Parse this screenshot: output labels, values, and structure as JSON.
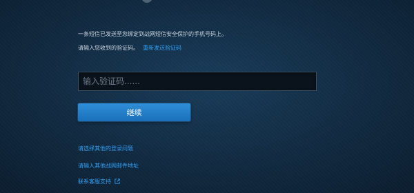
{
  "colors": {
    "link": "#2f9df1",
    "button": "#1f7cc7",
    "background": "#12304a"
  },
  "verification": {
    "sent_message": "一条短信已发送至您绑定到战网短信安全保护的手机号码上。",
    "prompt": "请输入您收到的验证码。",
    "resend_link": "重新发送验证码",
    "code_placeholder": "输入验证码......",
    "code_value": "",
    "continue_label": "继续"
  },
  "links": {
    "other_login_issue": "请选择其他的登录问题",
    "other_email": "请输入其他战网邮件地址",
    "contact_support": "联系客服支持"
  },
  "icons": {
    "contact_support_icon": "external-link-icon"
  }
}
